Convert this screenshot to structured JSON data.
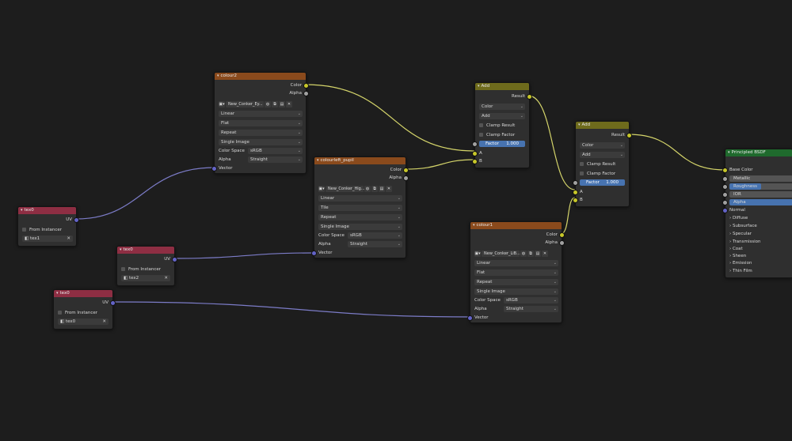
{
  "nodes": {
    "tex0_a": {
      "title": "tex0",
      "output_uv": "UV",
      "from_instancer": "From Instancer",
      "attribute": "tex1"
    },
    "tex0_b": {
      "title": "tex0",
      "output_uv": "UV",
      "from_instancer": "From Instancer",
      "attribute": "tex2"
    },
    "tex0_c": {
      "title": "tex0",
      "output_uv": "UV",
      "from_instancer": "From Instancer",
      "attribute": "tex0"
    },
    "colour2": {
      "title": "colour2",
      "out_color": "Color",
      "out_alpha": "Alpha",
      "image_name": "New_Conker_Ey...",
      "interpolation": "Linear",
      "projection": "Flat",
      "extension": "Repeat",
      "source": "Single Image",
      "color_space_label": "Color Space",
      "color_space": "sRGB",
      "alpha_label": "Alpha",
      "alpha": "Straight",
      "in_vector": "Vector"
    },
    "colourleft": {
      "title": "colourleft_pupil",
      "out_color": "Color",
      "out_alpha": "Alpha",
      "image_name": "New_Conker_Hig...",
      "interpolation": "Linear",
      "projection": "Tile",
      "extension": "Repeat",
      "source": "Single Image",
      "color_space_label": "Color Space",
      "color_space": "sRGB",
      "alpha_label": "Alpha",
      "alpha": "Straight",
      "in_vector": "Vector"
    },
    "colour1": {
      "title": "colour1",
      "out_color": "Color",
      "out_alpha": "Alpha",
      "image_name": "New_Conker_LiB...",
      "interpolation": "Linear",
      "projection": "Flat",
      "extension": "Repeat",
      "source": "Single Image",
      "color_space_label": "Color Space",
      "color_space": "sRGB",
      "alpha_label": "Alpha",
      "alpha": "Straight",
      "in_vector": "Vector"
    },
    "add1": {
      "title": "Add",
      "out_result": "Result",
      "data_type": "Color",
      "blend": "Add",
      "clamp_result": "Clamp Result",
      "clamp_factor": "Clamp Factor",
      "factor_label": "Factor",
      "factor_value": "1.000",
      "in_a": "A",
      "in_b": "B"
    },
    "add2": {
      "title": "Add",
      "out_result": "Result",
      "data_type": "Color",
      "blend": "Add",
      "clamp_result": "Clamp Result",
      "clamp_factor": "Clamp Factor",
      "factor_label": "Factor",
      "factor_value": "1.000",
      "in_a": "A",
      "in_b": "B"
    },
    "bsdf": {
      "title": "Principled BSDF",
      "base_color": "Base Color",
      "metallic": "Metallic",
      "roughness": "Roughness",
      "ior": "IOR",
      "alpha": "Alpha",
      "normal": "Normal",
      "panels": [
        "Diffuse",
        "Subsurface",
        "Specular",
        "Transmission",
        "Coat",
        "Sheen",
        "Emission",
        "Thin Film"
      ]
    }
  },
  "colors": {
    "background": "#1d1d1d",
    "node_body": "#2f2f2f",
    "texcoord_header": "#8e2e43",
    "image_header": "#8a4a1c",
    "mix_header": "#6e6b1c",
    "shader_header": "#1f6a2d",
    "socket_color": "#c7c729",
    "socket_vector": "#6363c7",
    "socket_float": "#a1a1a1",
    "socket_shader": "#63c763",
    "field_blue": "#4773b0"
  },
  "values": {
    "add1_factor": 1.0,
    "add2_factor": 1.0,
    "roughness_fill": 0.5
  }
}
